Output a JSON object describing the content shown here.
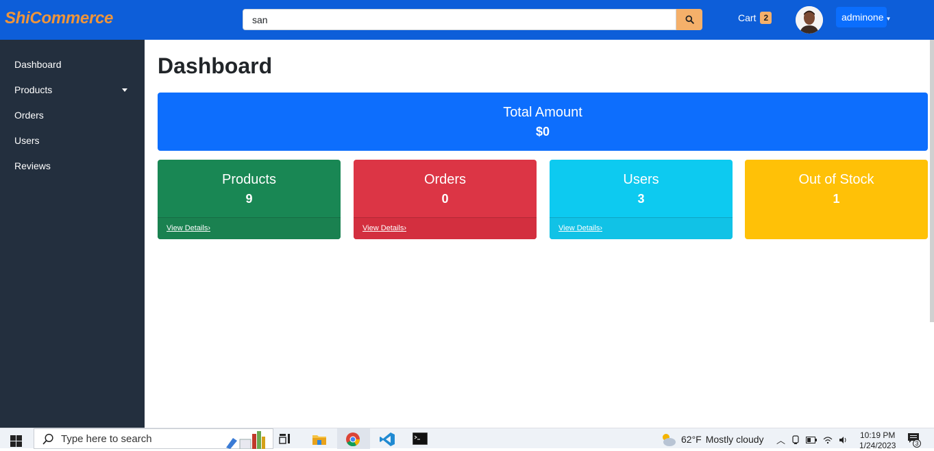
{
  "header": {
    "brand": "ShiCommerce",
    "search_value": "san",
    "cart_label": "Cart",
    "cart_count": "2",
    "user_name": "adminone"
  },
  "sidebar": {
    "items": [
      {
        "label": "Dashboard"
      },
      {
        "label": "Products"
      },
      {
        "label": "Orders"
      },
      {
        "label": "Users"
      },
      {
        "label": "Reviews"
      }
    ]
  },
  "main": {
    "title": "Dashboard",
    "total": {
      "label": "Total Amount",
      "value": "$0"
    },
    "cards": [
      {
        "label": "Products",
        "value": "9",
        "link": "View Details"
      },
      {
        "label": "Orders",
        "value": "0",
        "link": "View Details"
      },
      {
        "label": "Users",
        "value": "3",
        "link": "View Details"
      },
      {
        "label": "Out of Stock",
        "value": "1"
      }
    ]
  },
  "taskbar": {
    "search_placeholder": "Type here to search",
    "weather_temp": "62°F",
    "weather_text": "Mostly cloudy",
    "time": "10:19 PM",
    "date": "1/24/2023",
    "notification_count": "3"
  },
  "colors": {
    "header": "#0d5ed9",
    "brand": "#f0953a",
    "sidebar": "#232f3e",
    "primary": "#0d6efd",
    "success": "#198754",
    "danger": "#dc3545",
    "info": "#0dcaf0",
    "warning": "#ffc107"
  }
}
